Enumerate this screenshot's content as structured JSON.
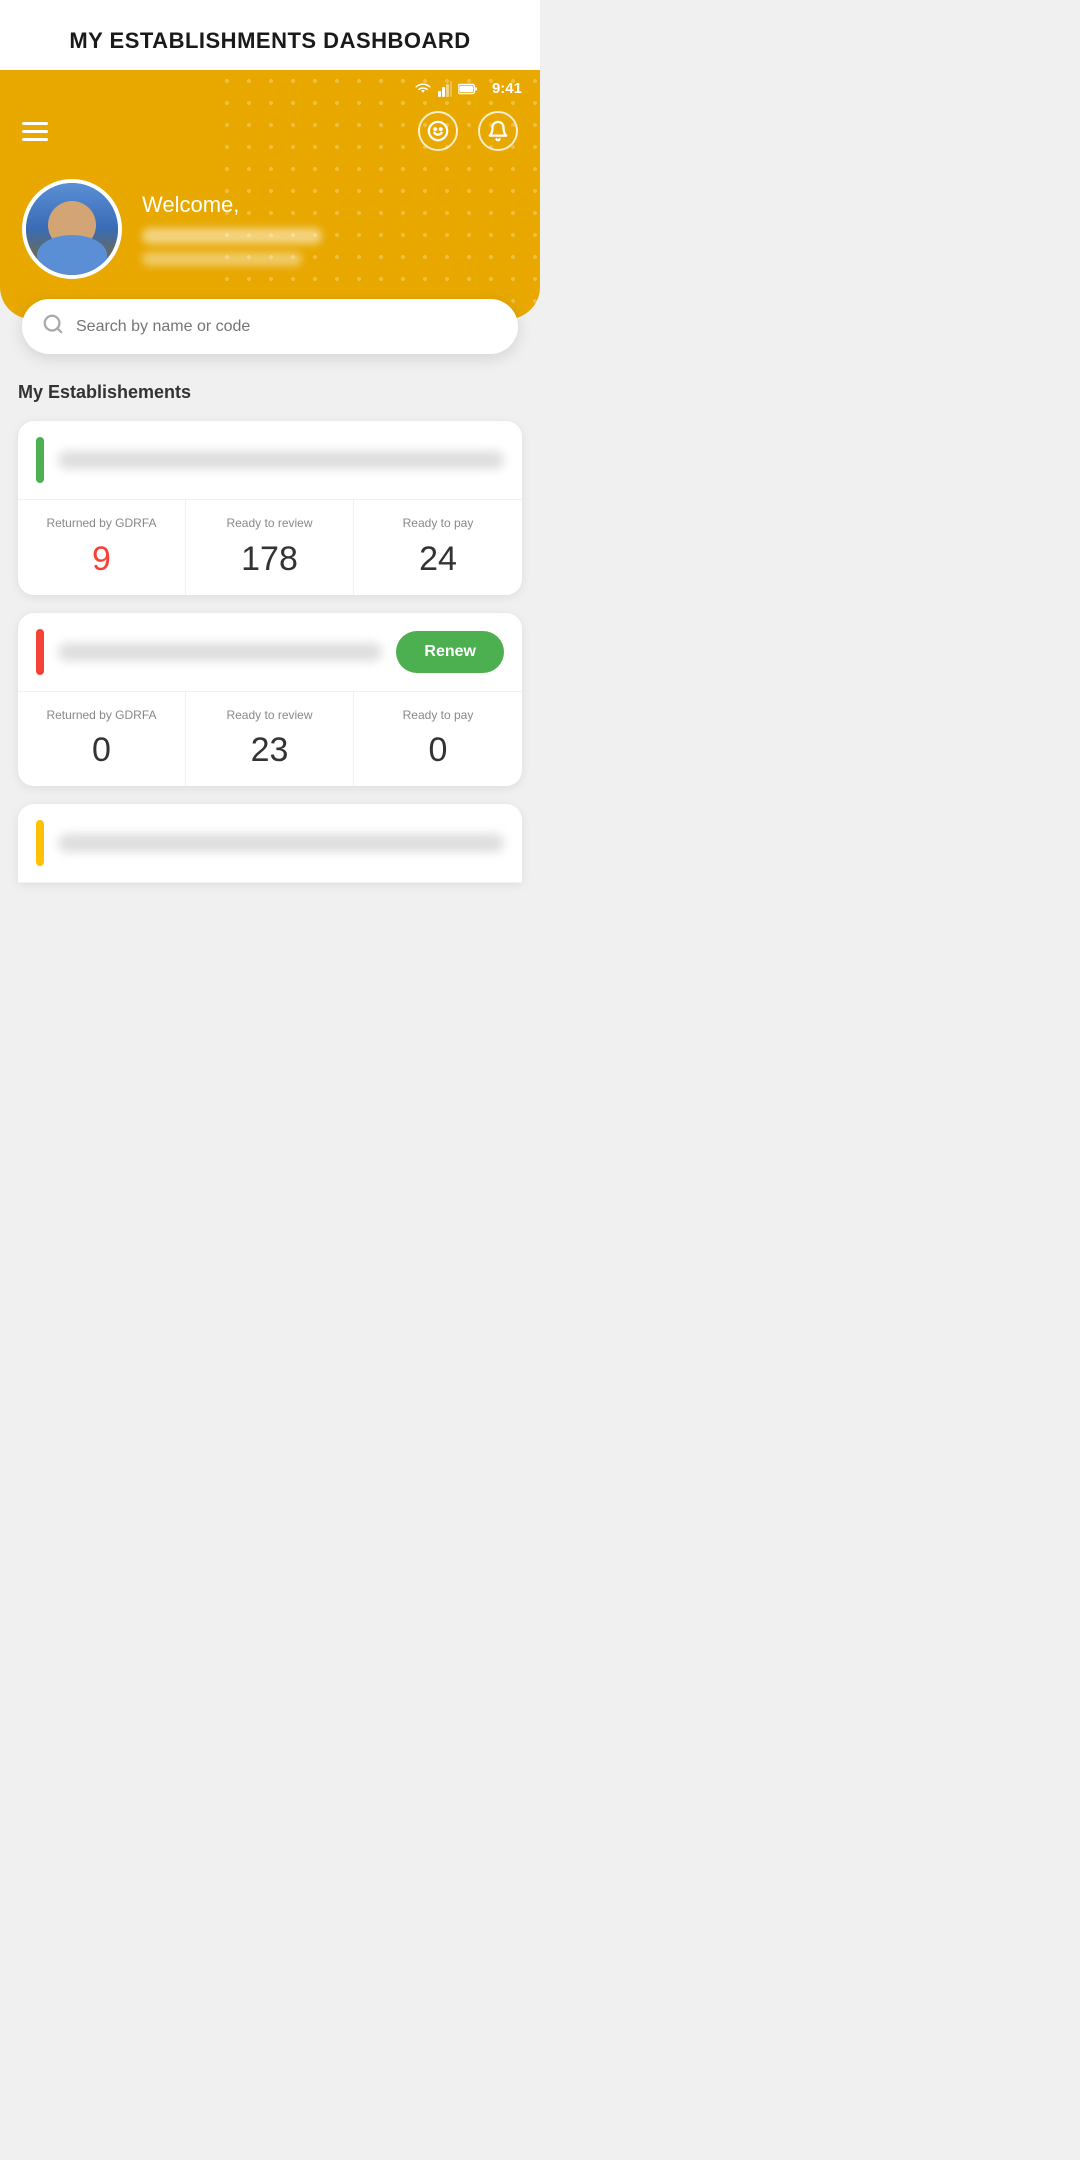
{
  "page": {
    "title": "MY ESTABLISHMENTS DASHBOARD"
  },
  "statusBar": {
    "time": "9:41"
  },
  "header": {
    "welcomeText": "Welcome,",
    "smiley": "☺",
    "bell": "🔔"
  },
  "search": {
    "placeholder": "Search by name or code"
  },
  "mainSection": {
    "title": "My Establishements"
  },
  "establishments": [
    {
      "id": 1,
      "nameBlurred": true,
      "statusColor": "green",
      "stats": {
        "returnedByGDRFA": {
          "label": "Returned by GDRFA",
          "value": "9",
          "color": "red"
        },
        "readyToReview": {
          "label": "Ready to review",
          "value": "178",
          "color": "normal"
        },
        "readyToPay": {
          "label": "Ready to pay",
          "value": "24",
          "color": "normal"
        }
      },
      "hasRenewBtn": false
    },
    {
      "id": 2,
      "nameBlurred": true,
      "statusColor": "red",
      "stats": {
        "returnedByGDRFA": {
          "label": "Returned by GDRFA",
          "value": "0",
          "color": "normal"
        },
        "readyToReview": {
          "label": "Ready to review",
          "value": "23",
          "color": "normal"
        },
        "readyToPay": {
          "label": "Ready to pay",
          "value": "0",
          "color": "normal"
        }
      },
      "hasRenewBtn": true,
      "renewLabel": "Renew"
    },
    {
      "id": 3,
      "nameBlurred": true,
      "statusColor": "yellow",
      "stats": {},
      "hasRenewBtn": false,
      "partial": true
    }
  ],
  "icons": {
    "hamburger": "≡",
    "search": "search-icon",
    "smiley": "smiley-icon",
    "bell": "bell-icon"
  }
}
